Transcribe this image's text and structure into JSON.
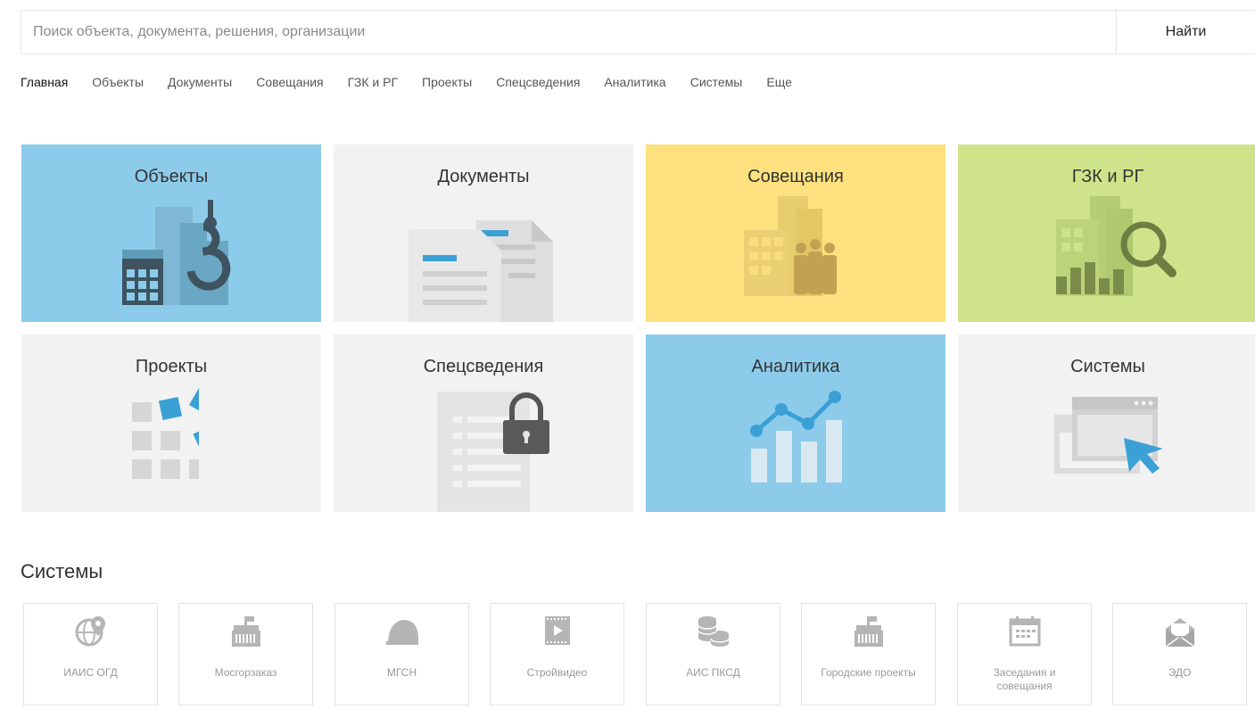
{
  "search": {
    "placeholder": "Поиск объекта, документа, решения, организации",
    "button": "Найти"
  },
  "nav": [
    "Главная",
    "Объекты",
    "Документы",
    "Совещания",
    "ГЗК и РГ",
    "Проекты",
    "Спецсведения",
    "Аналитика",
    "Системы",
    "Еще"
  ],
  "tiles": [
    "Объекты",
    "Документы",
    "Совещания",
    "ГЗК и РГ",
    "Проекты",
    "Спецсведения",
    "Аналитика",
    "Системы"
  ],
  "systems": {
    "title": "Системы",
    "items": [
      "ИАИС ОГД",
      "Мосгорзаказ",
      "МГСН",
      "Стройвидео",
      "АИС ПКСД",
      "Городские проекты",
      "Заседания и совещания",
      "ЭДО"
    ]
  },
  "colors": {
    "blue": "#8ccbea",
    "grey": "#f2f2f2",
    "yellow": "#fde17e",
    "green": "#cfe48a",
    "accent": "#3ba0d6"
  },
  "icons": [
    "building-crane-icon",
    "documents-icon",
    "meeting-icon",
    "analysis-magnifier-icon",
    "projects-blocks-icon",
    "secure-document-lock-icon",
    "analytics-chart-icon",
    "systems-window-cursor-icon"
  ]
}
